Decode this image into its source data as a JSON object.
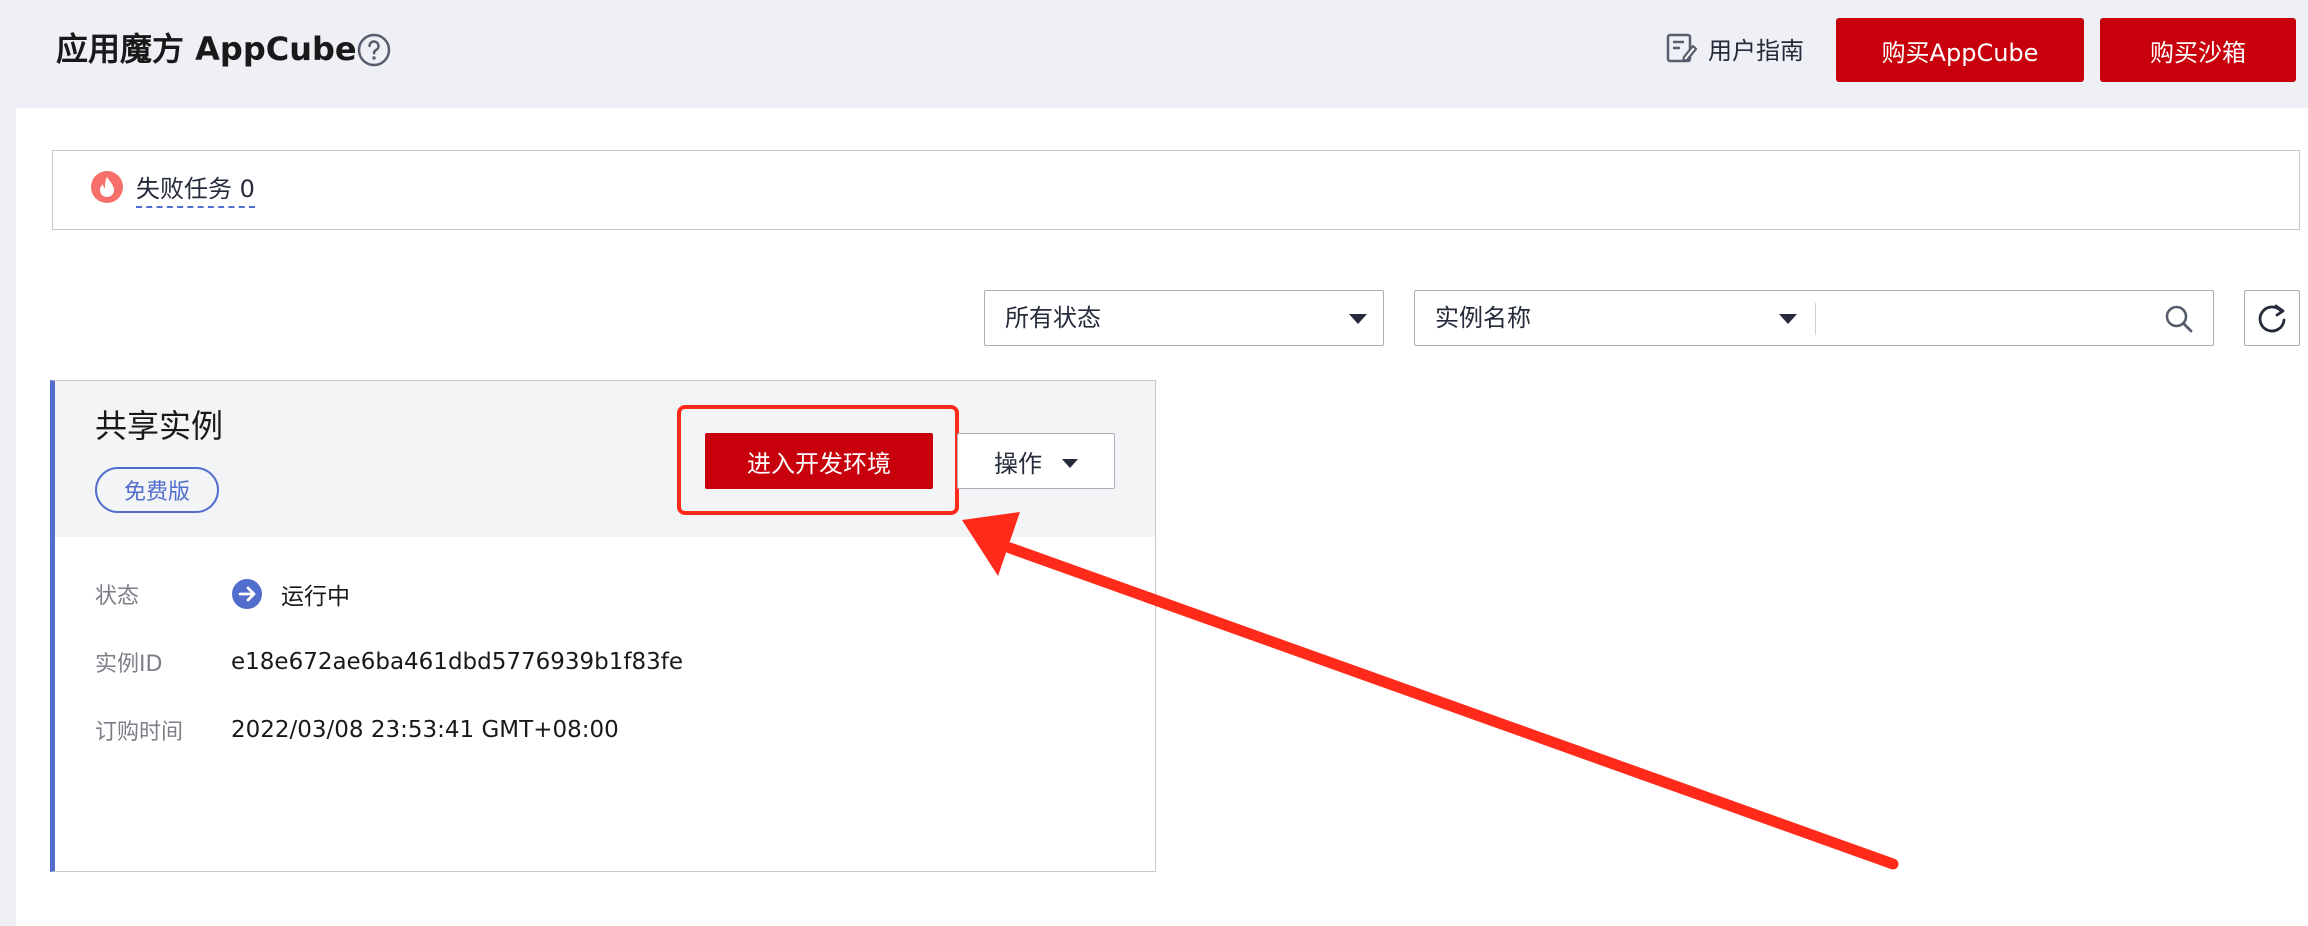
{
  "header": {
    "app_title": "应用魔方 AppCube",
    "guide_label": "用户指南",
    "buy_appcube_label": "购买AppCube",
    "buy_sandbox_label": "购买沙箱"
  },
  "tasks": {
    "failed_label": "失败任务 0"
  },
  "filters": {
    "status_selected": "所有状态",
    "search_field_selected": "实例名称",
    "search_value": ""
  },
  "instance_card": {
    "title": "共享实例",
    "edition_tag": "免费版",
    "enter_dev_label": "进入开发环境",
    "operations_label": "操作",
    "status_label": "状态",
    "status_value": "运行中",
    "id_label": "实例ID",
    "id_value": "e18e672ae6ba461dbd5776939b1f83fe",
    "order_time_label": "订购时间",
    "order_time_value": "2022/03/08 23:53:41 GMT+08:00"
  },
  "colors": {
    "brand_red": "#c7000b",
    "accent_blue": "#526ecc",
    "annotation_red": "#ff2a1a"
  }
}
